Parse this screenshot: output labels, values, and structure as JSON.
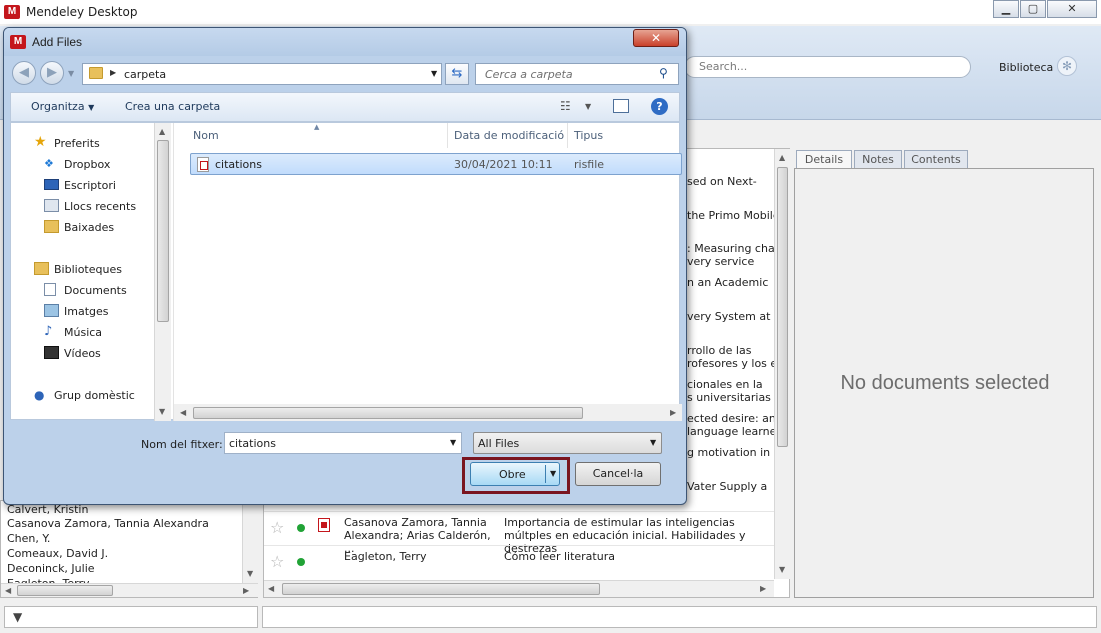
{
  "main_window": {
    "title": "Mendeley Desktop",
    "search_placeholder": "Search...",
    "library_label": "Biblioteca",
    "list_partial_titles": [
      "sed on Next-",
      "the Primo Mobile",
      ": Measuring chang",
      "very service",
      "n an Academic",
      "very System at an",
      "rrollo de las",
      "rofesores y los es",
      "cionales en la",
      "s universitarias",
      "ected desire: an",
      "language learner",
      "g motivation in a",
      "Vater Supply a"
    ],
    "list_rows": [
      {
        "authors": "Casanova Zamora, Tannia Alexandra; Arias Calderón, ...",
        "title": "Importancia de estimular las inteligencias múltples en educación inicial. Habilidades y destrezas"
      },
      {
        "authors": "Eagleton, Terry",
        "title": "Cómo leer literatura"
      }
    ],
    "authors_panel": [
      "Calvert, Kristin",
      "Casanova Zamora, Tannia Alexandra",
      "Chen, Y.",
      "Comeaux, David J.",
      "Deconinck, Julie",
      "Eagleton, Terry"
    ],
    "detail_tabs": [
      "Details",
      "Notes",
      "Contents"
    ],
    "no_selection_text": "No documents selected"
  },
  "dialog": {
    "title": "Add Files",
    "close_glyph": "✕",
    "breadcrumb_folder": "carpeta",
    "search_placeholder": "Cerca a carpeta",
    "organize_label": "Organitza",
    "new_folder_label": "Crea una carpeta",
    "nav": {
      "favorites": "Preferits",
      "dropbox": "Dropbox",
      "desktop": "Escriptori",
      "recent": "Llocs recents",
      "downloads": "Baixades",
      "libraries": "Biblioteques",
      "documents": "Documents",
      "images": "Imatges",
      "music": "Música",
      "videos": "Vídeos",
      "homegroup": "Grup domèstic"
    },
    "columns": {
      "name": "Nom",
      "modified": "Data de modificació",
      "type": "Tipus"
    },
    "files": [
      {
        "name": "citations",
        "modified": "30/04/2021 10:11",
        "type": "risfile"
      }
    ],
    "filename_label": "Nom del fitxer:",
    "filename_value": "citations",
    "filetype_value": "All Files",
    "open_label": "Obre",
    "cancel_label": "Cancel·la"
  },
  "colors": {
    "mendeley_red": "#c4161c",
    "highlight_border": "#7a1520",
    "selection_blue": "#c1dcfc"
  }
}
